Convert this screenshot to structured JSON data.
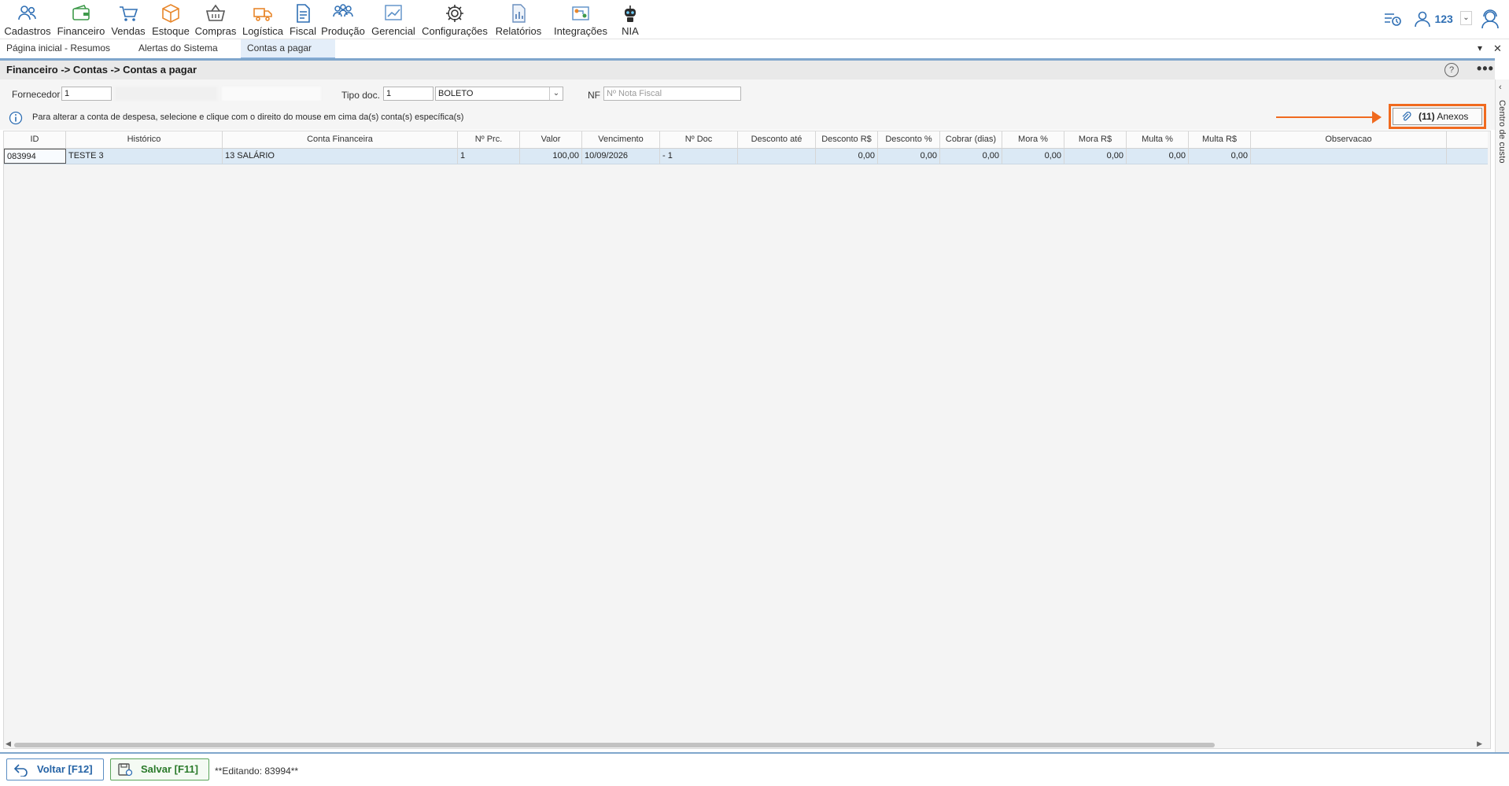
{
  "toolbar": {
    "items": [
      {
        "label": "Cadastros",
        "icon": "users-icon"
      },
      {
        "label": "Financeiro",
        "icon": "wallet-icon"
      },
      {
        "label": "Vendas",
        "icon": "cart-icon"
      },
      {
        "label": "Estoque",
        "icon": "box-icon"
      },
      {
        "label": "Compras",
        "icon": "basket-icon"
      },
      {
        "label": "Logística",
        "icon": "truck-icon"
      },
      {
        "label": "Fiscal",
        "icon": "document-icon"
      },
      {
        "label": "Produção",
        "icon": "team-icon"
      },
      {
        "label": "Gerencial",
        "icon": "chart-icon"
      },
      {
        "label": "Configurações",
        "icon": "gear-icon"
      },
      {
        "label": "Relatórios",
        "icon": "report-icon"
      },
      {
        "label": "Integrações",
        "icon": "integration-icon"
      },
      {
        "label": "NIA",
        "icon": "robot-icon"
      }
    ],
    "user_label": "123"
  },
  "tabs": [
    {
      "label": "Página inicial - Resumos",
      "active": false
    },
    {
      "label": "Alertas do Sistema",
      "active": false
    },
    {
      "label": "Contas a pagar",
      "active": true
    }
  ],
  "breadcrumb": "Financeiro -> Contas -> Contas a pagar",
  "side_panel_label": "Centro de custo",
  "form": {
    "fornecedor_label": "Fornecedor",
    "fornecedor_value": "1",
    "tipo_doc_label": "Tipo doc.",
    "tipo_doc_value": "1",
    "tipo_doc_select": "BOLETO",
    "nf_label": "NF",
    "nf_placeholder": "Nº Nota Fiscal",
    "info_text": "Para alterar a conta de despesa, selecione e clique com o direito do mouse em cima da(s) conta(s) específica(s)",
    "anexos_count": "(11)",
    "anexos_label": "Anexos"
  },
  "grid": {
    "columns": [
      "ID",
      "Histórico",
      "Conta Financeira",
      "Nº Prc.",
      "Valor",
      "Vencimento",
      "Nº Doc",
      "Desconto até",
      "Desconto R$",
      "Desconto %",
      "Cobrar (dias)",
      "Mora %",
      "Mora R$",
      "Multa %",
      "Multa R$",
      "Observacao"
    ],
    "rows": [
      [
        "083994",
        "TESTE 3",
        "13 SALÁRIO",
        "1",
        "100,00",
        "10/09/2026",
        "- 1",
        "",
        "0,00",
        "0,00",
        "0,00",
        "0,00",
        "0,00",
        "0,00",
        "0,00",
        ""
      ]
    ]
  },
  "bottom": {
    "voltar_label": "Voltar [F12]",
    "salvar_label": "Salvar [F11]",
    "status": "**Editando: 83994**"
  },
  "colors": {
    "accent": "#7fa6cc",
    "highlight": "#f06a1f",
    "row_selected": "#dbe9f5"
  }
}
